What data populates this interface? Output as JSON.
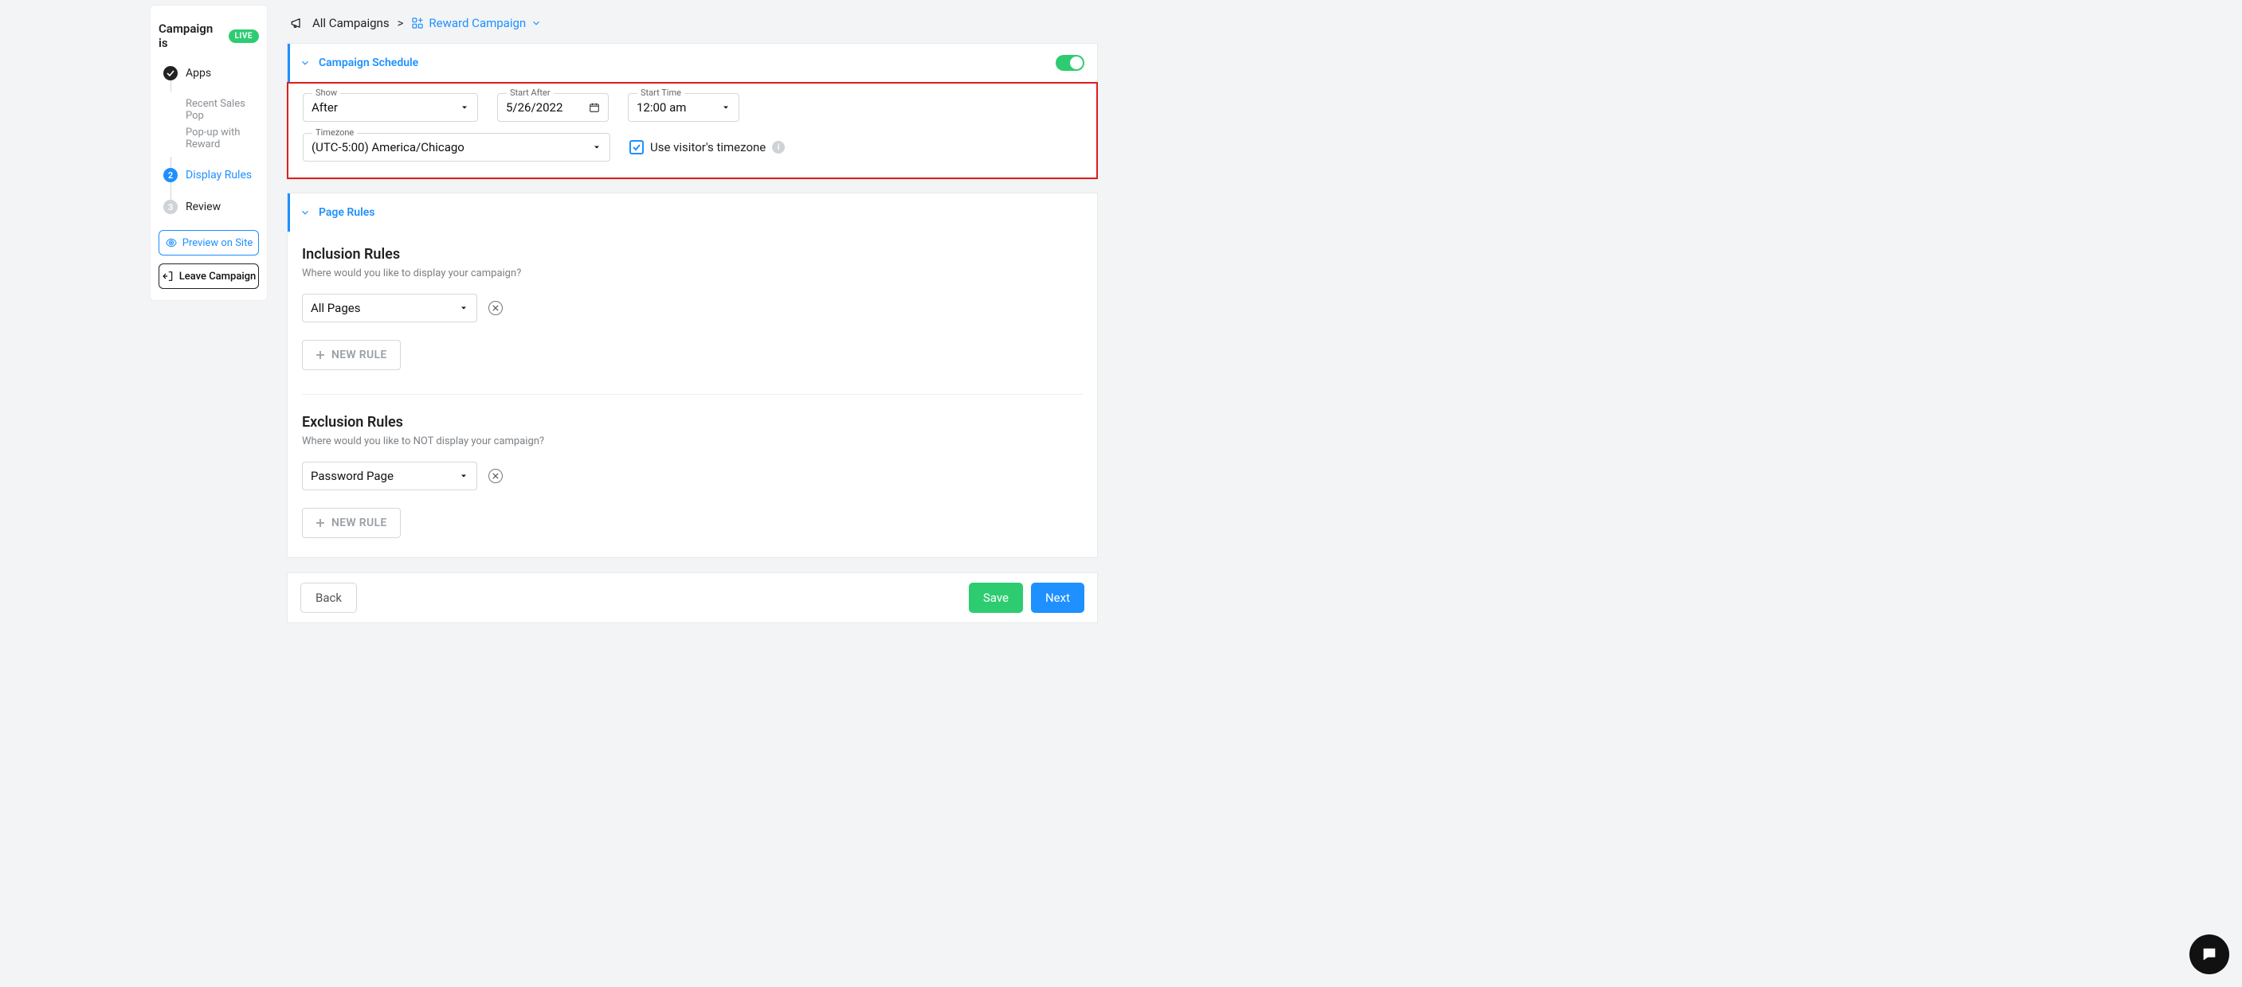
{
  "sidebar": {
    "title": "Campaign is",
    "live_badge": "LIVE",
    "steps": [
      {
        "label": "Apps",
        "sub": [
          "Recent Sales Pop",
          "Pop-up with Reward"
        ]
      },
      {
        "label": "Display Rules"
      },
      {
        "label": "Review"
      }
    ],
    "preview_label": "Preview on Site",
    "leave_label": "Leave Campaign"
  },
  "breadcrumb": {
    "root": "All Campaigns",
    "sep": ">",
    "current": "Reward Campaign"
  },
  "schedule": {
    "title": "Campaign Schedule",
    "show_label": "Show",
    "show_value": "After",
    "start_after_label": "Start After",
    "start_after_value": "5/26/2022",
    "start_time_label": "Start Time",
    "start_time_value": "12:00 am",
    "timezone_label": "Timezone",
    "timezone_value": "(UTC-5:00) America/Chicago",
    "visitor_tz_label": "Use visitor's timezone"
  },
  "page_rules": {
    "title": "Page Rules",
    "inclusion_title": "Inclusion Rules",
    "inclusion_sub": "Where would you like to display your campaign?",
    "inclusion_value": "All Pages",
    "exclusion_title": "Exclusion Rules",
    "exclusion_sub": "Where would you like to NOT display your campaign?",
    "exclusion_value": "Password Page",
    "new_rule_label": "NEW RULE"
  },
  "footer": {
    "back": "Back",
    "save": "Save",
    "next": "Next"
  }
}
